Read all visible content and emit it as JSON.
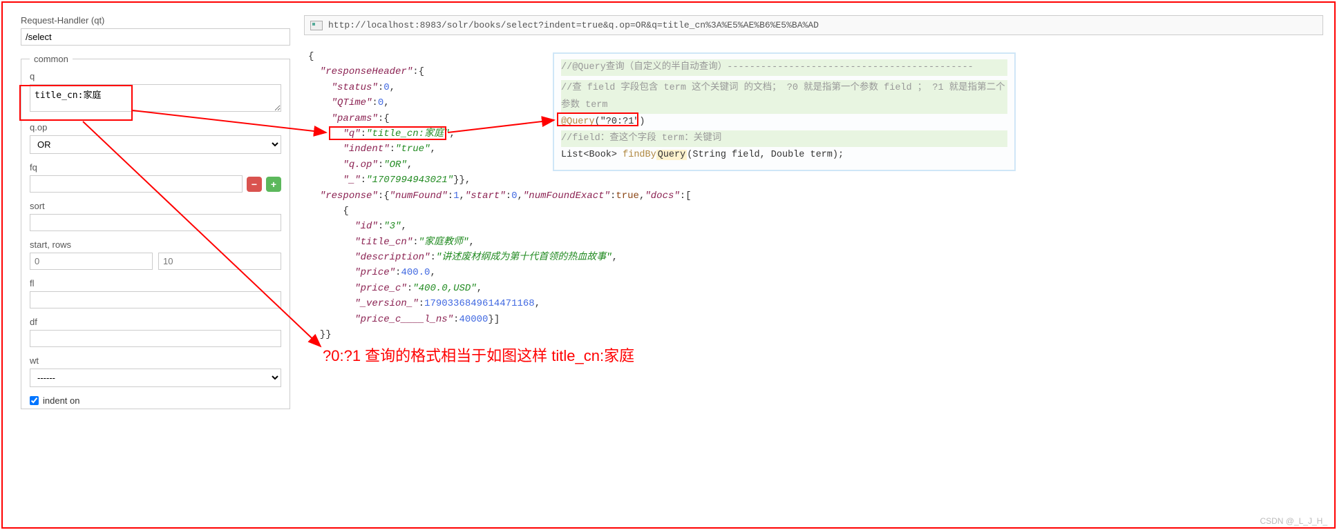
{
  "sidebar": {
    "request_handler_label": "Request-Handler (qt)",
    "request_handler_value": "/select",
    "common_legend": "common",
    "q_label": "q",
    "q_value": "title_cn:家庭",
    "qop_label": "q.op",
    "qop_value": "OR",
    "fq_label": "fq",
    "fq_value": "",
    "sort_label": "sort",
    "sort_value": "",
    "startrows_label": "start, rows",
    "start_placeholder": "0",
    "rows_placeholder": "10",
    "fl_label": "fl",
    "fl_value": "",
    "df_label": "df",
    "df_value": "",
    "wt_label": "wt",
    "wt_value": "------",
    "indent_label": "indent on"
  },
  "url_bar": {
    "url": "http://localhost:8983/solr/books/select?indent=true&q.op=OR&q=title_cn%3A%E5%AE%B6%E5%BA%AD"
  },
  "json": {
    "responseHeader_status": "0",
    "responseHeader_QTime": "0",
    "params_q": "title_cn:家庭",
    "params_indent": "true",
    "params_qop": "OR",
    "params_underscore": "1707994943021",
    "response_numFound": "1",
    "response_start": "0",
    "response_numFoundExact": "true",
    "doc_id": "3",
    "doc_title_cn": "家庭教师",
    "doc_description": "讲述废材纲成为第十代首领的热血故事",
    "doc_price": "400.0",
    "doc_price_c": "400.0,USD",
    "doc_version": "1790336849614471168",
    "doc_price_c_1_ns": "40000"
  },
  "code_overlay": {
    "line1": "//@Query查询（自定义的半自动查询）--------------------------------------------",
    "line2": "//查 field 字段包含 term 这个关键词 的文档；  ?0 就是指第一个参数 field ； ?1 就是指第二个参数 term",
    "line3_anno": "@Query",
    "line3_arg": "(\"?0:?1\")",
    "line4": "//field：查这个字段     term：关键词",
    "line5_pre": "List<Book> ",
    "line5_fn": "findBy",
    "line5_hl": "Query",
    "line5_post": "(String field, Double term);"
  },
  "annotation": {
    "text": "?0:?1    查询的格式相当于如图这样    title_cn:家庭"
  },
  "watermark": "CSDN @_L_J_H_"
}
